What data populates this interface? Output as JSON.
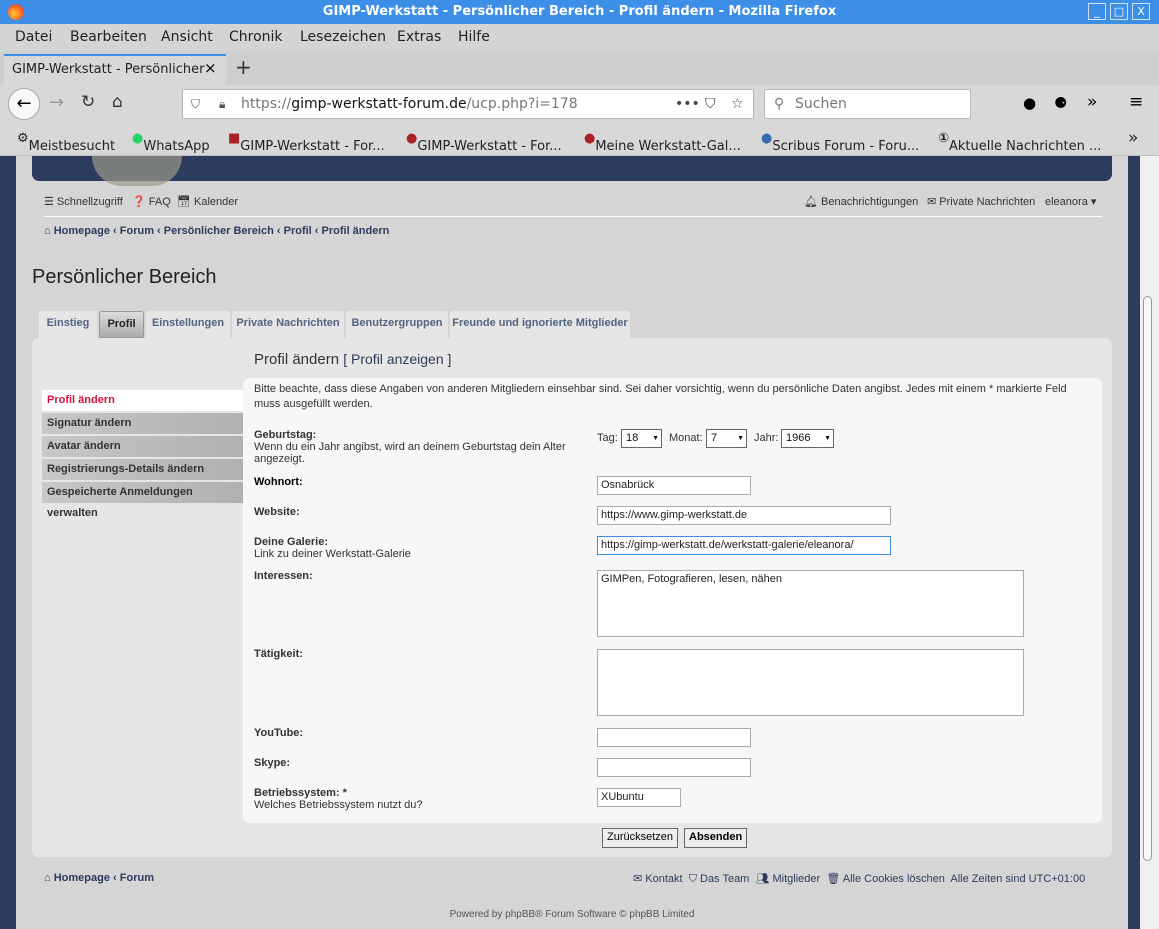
{
  "window": {
    "title": "GIMP-Werkstatt - Persönlicher Bereich - Profil ändern - Mozilla Firefox",
    "min": "_",
    "max": "□",
    "close": "X"
  },
  "menu": [
    "Datei",
    "Bearbeiten",
    "Ansicht",
    "Chronik",
    "Lesezeichen",
    "Extras",
    "Hilfe"
  ],
  "tab": {
    "title": "GIMP-Werkstatt - Persönlicher",
    "close": "×",
    "new": "+"
  },
  "nav": {
    "url_prefix": "https://",
    "url_domain": "gimp-werkstatt-forum.de",
    "url_path": "/ucp.php?i=178",
    "search_placeholder": "Suchen"
  },
  "bookmarks": [
    "Meistbesucht",
    "WhatsApp",
    "GIMP-Werkstatt - For...",
    "GIMP-Werkstatt - For...",
    "Meine Werkstatt-Gal...",
    "Scribus Forum - Foru...",
    "Aktuelle Nachrichten ..."
  ],
  "top_links": {
    "quick": "Schnellzugriff",
    "faq": "FAQ",
    "calendar": "Kalender",
    "notifications": "Benachrichtigungen",
    "pm": "Private Nachrichten",
    "user": "eleanora"
  },
  "breadcrumb": [
    "Homepage",
    "Forum",
    "Persönlicher Bereich",
    "Profil",
    "Profil ändern"
  ],
  "page_title": "Persönlicher Bereich",
  "tabs": [
    "Einstieg",
    "Profil",
    "Einstellungen",
    "Private Nachrichten",
    "Benutzergruppen",
    "Freunde und ignorierte Mitglieder"
  ],
  "sidebar": [
    "Profil ändern",
    "Signatur ändern",
    "Avatar ändern",
    "Registrierungs-Details ändern",
    "Gespeicherte Anmeldungen verwalten"
  ],
  "form": {
    "title": "Profil ändern",
    "view_link": "[ Profil anzeigen ]",
    "notice": "Bitte beachte, dass diese Angaben von anderen Mitgliedern einsehbar sind. Sei daher vorsichtig, wenn du persönliche Daten angibst. Jedes mit einem * markierte Feld muss ausgefüllt werden.",
    "birthday": {
      "label": "Geburtstag:",
      "hint": "Wenn du ein Jahr angibst, wird an deinem Geburtstag dein Alter angezeigt.",
      "day_label": "Tag:",
      "day": "18",
      "month_label": "Monat:",
      "month": "7",
      "year_label": "Jahr:",
      "year": "1966"
    },
    "location": {
      "label": "Wohnort:",
      "value": "Osnabrück"
    },
    "website": {
      "label": "Website:",
      "value": "https://www.gimp-werkstatt.de"
    },
    "gallery": {
      "label": "Deine Galerie:",
      "hint": "Link zu deiner Werkstatt-Galerie",
      "value": "https://gimp-werkstatt.de/werkstatt-galerie/eleanora/"
    },
    "interests": {
      "label": "Interessen:",
      "value": "GIMPen, Fotografieren, lesen, nähen"
    },
    "occupation": {
      "label": "Tätigkeit:",
      "value": ""
    },
    "youtube": {
      "label": "YouTube:",
      "value": ""
    },
    "skype": {
      "label": "Skype:",
      "value": ""
    },
    "os": {
      "label": "Betriebssystem: *",
      "hint": "Welches Betriebssystem nutzt du?",
      "value": "XUbuntu"
    },
    "reset": "Zurücksetzen",
    "submit": "Absenden"
  },
  "footer": {
    "home": "Homepage",
    "forum": "Forum",
    "contact": "Kontakt",
    "team": "Das Team",
    "members": "Mitglieder",
    "cookies": "Alle Cookies löschen",
    "timezone": "Alle Zeiten sind UTC+01:00",
    "powered": "Powered by phpBB® Forum Software © phpBB Limited"
  }
}
